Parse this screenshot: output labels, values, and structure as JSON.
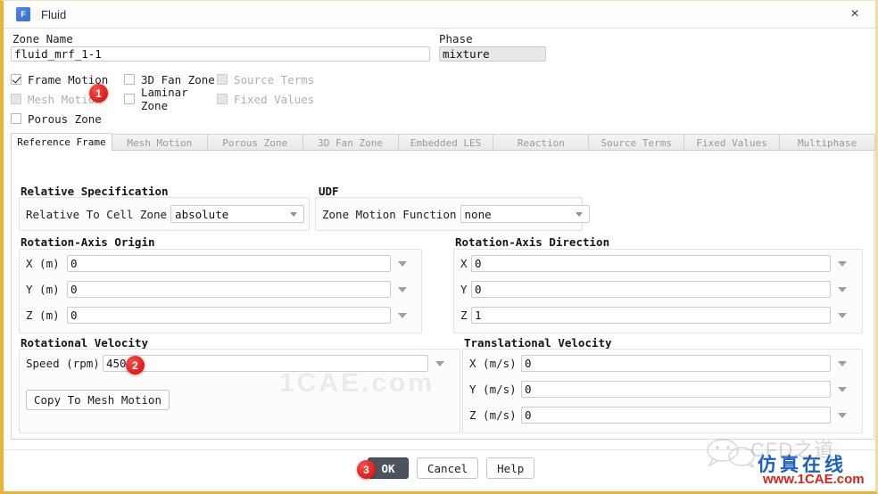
{
  "window": {
    "title": "Fluid",
    "icon": "fluent-app-icon",
    "close_label": "×"
  },
  "form": {
    "zone_name_label": "Zone Name",
    "zone_name_value": "fluid_mrf_1-1",
    "phase_label": "Phase",
    "phase_value": "mixture"
  },
  "checkboxes": [
    {
      "label": "Frame Motion",
      "checked": true,
      "disabled": false
    },
    {
      "label": "3D Fan Zone",
      "checked": false,
      "disabled": false
    },
    {
      "label": "Source Terms",
      "checked": false,
      "disabled": true
    },
    {
      "label": "Mesh Motion",
      "checked": false,
      "disabled": true
    },
    {
      "label": "Laminar Zone",
      "checked": false,
      "disabled": false
    },
    {
      "label": "Fixed Values",
      "checked": false,
      "disabled": true
    },
    {
      "label": "Porous Zone",
      "checked": false,
      "disabled": false
    }
  ],
  "tabs": [
    {
      "label": "Reference Frame",
      "active": true
    },
    {
      "label": "Mesh Motion",
      "active": false
    },
    {
      "label": "Porous Zone",
      "active": false
    },
    {
      "label": "3D Fan Zone",
      "active": false
    },
    {
      "label": "Embedded LES",
      "active": false
    },
    {
      "label": "Reaction",
      "active": false
    },
    {
      "label": "Source Terms",
      "active": false
    },
    {
      "label": "Fixed Values",
      "active": false
    },
    {
      "label": "Multiphase",
      "active": false
    }
  ],
  "relative_specification": {
    "title": "Relative Specification",
    "field_label": "Relative To Cell Zone",
    "value": "absolute"
  },
  "udf": {
    "title": "UDF",
    "field_label": "Zone Motion Function",
    "value": "none"
  },
  "rotation_axis_origin": {
    "title": "Rotation-Axis Origin",
    "fields": [
      {
        "label": "X (m)",
        "value": "0"
      },
      {
        "label": "Y (m)",
        "value": "0"
      },
      {
        "label": "Z (m)",
        "value": "0"
      }
    ]
  },
  "rotation_axis_direction": {
    "title": "Rotation-Axis Direction",
    "fields": [
      {
        "label": "X",
        "value": "0"
      },
      {
        "label": "Y",
        "value": "0"
      },
      {
        "label": "Z",
        "value": "1"
      }
    ]
  },
  "rotational_velocity": {
    "title": "Rotational Velocity",
    "speed_label": "Speed (rpm)",
    "speed_value": "450",
    "copy_button": "Copy To Mesh Motion"
  },
  "translational_velocity": {
    "title": "Translational Velocity",
    "fields": [
      {
        "label": "X (m/s)",
        "value": "0"
      },
      {
        "label": "Y (m/s)",
        "value": "0"
      },
      {
        "label": "Z (m/s)",
        "value": "0"
      }
    ]
  },
  "footer": {
    "ok": "OK",
    "cancel": "Cancel",
    "help": "Help"
  },
  "annotations": [
    {
      "number": "1"
    },
    {
      "number": "2"
    },
    {
      "number": "3"
    }
  ],
  "watermarks": {
    "center": "1CAE.com",
    "brand_en": "CFD之道",
    "brand_cn": "仿真在线",
    "url": "www.1CAE.com"
  },
  "colors": {
    "accent_border": "#e8b33a",
    "primary_button": "#4b545e",
    "badge": "#e01b16",
    "brand_blue": "#1f5fc4",
    "brand_red": "#d8251c"
  }
}
